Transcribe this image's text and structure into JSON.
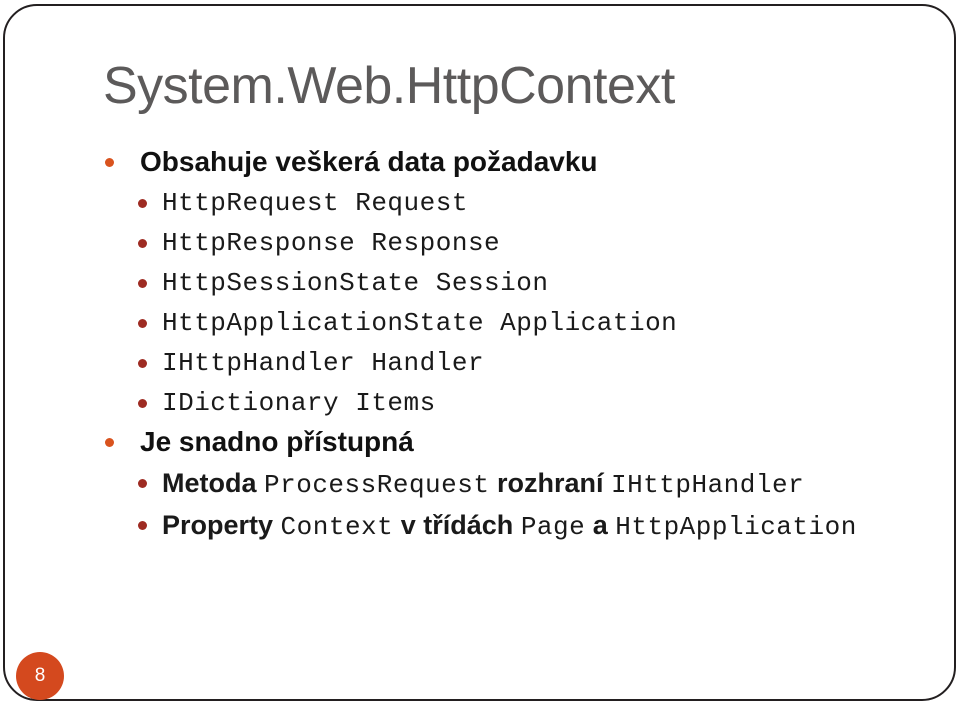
{
  "slide": {
    "title": "System.Web.HttpContext",
    "page_number": "8",
    "colors": {
      "title": "#5c5a5a",
      "bullet_level1": "#d9531e",
      "bullet_level2": "#9e2b22",
      "badge": "#d4491e",
      "frame": "#231f20",
      "background": "#ffffff"
    }
  },
  "content": {
    "items": [
      {
        "level": 1,
        "text": "Obsahuje veškerá data požadavku"
      },
      {
        "level": 2,
        "text": "HttpRequest Request"
      },
      {
        "level": 2,
        "text": "HttpResponse Response"
      },
      {
        "level": 2,
        "text": "HttpSessionState Session"
      },
      {
        "level": 2,
        "text": "HttpApplicationState Application"
      },
      {
        "level": 2,
        "text": "IHttpHandler Handler"
      },
      {
        "level": 2,
        "text": "IDictionary Items"
      },
      {
        "level": 1,
        "text": "Je snadno přístupná"
      },
      {
        "level": 2,
        "runs": [
          {
            "style": "sans",
            "text": "Metoda "
          },
          {
            "style": "mono",
            "text": "ProcessRequest"
          },
          {
            "style": "sans",
            "text": " rozhraní "
          },
          {
            "style": "mono",
            "text": "IHttpHandler"
          }
        ]
      },
      {
        "level": 2,
        "runs": [
          {
            "style": "sans",
            "text": "Property "
          },
          {
            "style": "mono",
            "text": "Context"
          },
          {
            "style": "sans",
            "text": " v třídách "
          },
          {
            "style": "mono",
            "text": "Page"
          },
          {
            "style": "sans",
            "text": " a "
          },
          {
            "style": "mono",
            "text": "HttpApplication"
          }
        ]
      }
    ]
  }
}
